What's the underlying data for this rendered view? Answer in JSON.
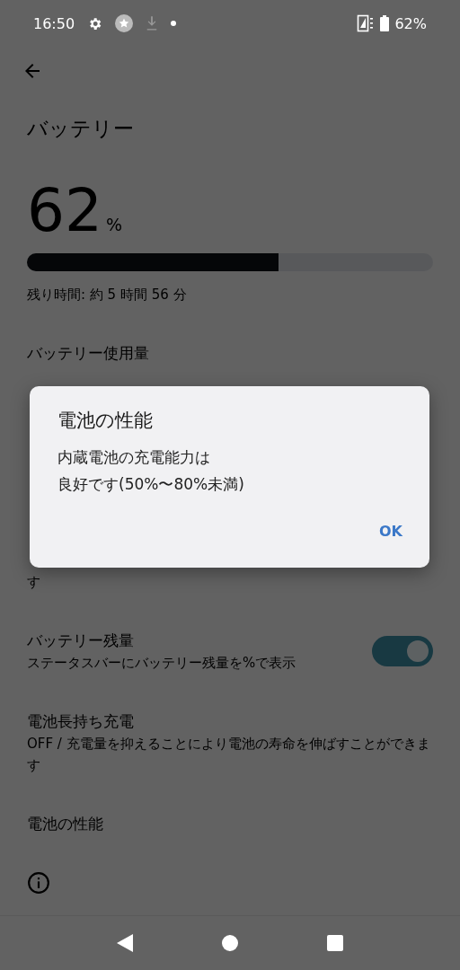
{
  "status_bar": {
    "time": "16:50",
    "battery": "62%"
  },
  "header": {
    "title": "バッテリー"
  },
  "battery": {
    "percent": "62",
    "unit": "%",
    "level": 0.62,
    "remaining": "残り時間: 約 5 時間 56 分"
  },
  "settings": [
    {
      "kind": "covered",
      "title": "バッテリー使用量"
    },
    {
      "kind": "tail",
      "text": "す"
    },
    {
      "kind": "toggle",
      "title": "バッテリー残量",
      "summary": "ステータスバーにバッテリー残量を%で表示",
      "on": true
    },
    {
      "kind": "text",
      "title": "電池長持ち充電",
      "summary": "OFF / 充電量を抑えることにより電池の寿命を伸ばすことができます"
    },
    {
      "kind": "text",
      "title": "電池の性能"
    },
    {
      "kind": "info"
    }
  ],
  "dialog": {
    "title": "電池の性能",
    "message_lines": [
      "内蔵電池の充電能力は",
      "良好です(50%〜80%未満)"
    ],
    "buttons": [
      "OK"
    ]
  }
}
